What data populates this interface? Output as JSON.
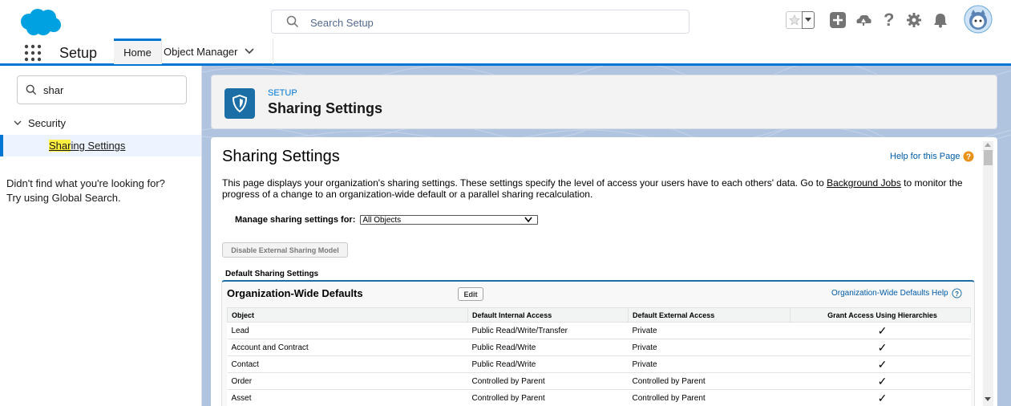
{
  "global_header": {
    "search_placeholder": "Search Setup"
  },
  "context_bar": {
    "app_name": "Setup",
    "tabs": [
      {
        "label": "Home"
      },
      {
        "label": "Object Manager"
      }
    ]
  },
  "sidebar": {
    "quickfind_value": "shar",
    "tree": {
      "section": "Security",
      "item_match": "Shar",
      "item_rest": "ing Settings"
    },
    "not_found_line1": "Didn't find what you're looking for?",
    "not_found_line2": "Try using Global Search."
  },
  "page_header": {
    "eyebrow": "SETUP",
    "title": "Sharing Settings"
  },
  "content": {
    "title": "Sharing Settings",
    "help_link": "Help for this Page",
    "intro_before": "This page displays your organization's sharing settings. These settings specify the level of access your users have to each others' data. Go to ",
    "intro_link": "Background Jobs",
    "intro_after": " to monitor the progress of a change to an organization-wide default or a parallel sharing recalculation.",
    "manage_label": "Manage sharing settings for:",
    "manage_value": "All Objects",
    "disable_button": "Disable External Sharing Model",
    "default_sharing_label": "Default Sharing Settings"
  },
  "owd": {
    "title": "Organization-Wide Defaults",
    "edit_label": "Edit",
    "help_link": "Organization-Wide Defaults Help",
    "columns": [
      "Object",
      "Default Internal Access",
      "Default External Access",
      "Grant Access Using Hierarchies"
    ],
    "rows": [
      {
        "object": "Lead",
        "internal": "Public Read/Write/Transfer",
        "external": "Private",
        "hier": "✓"
      },
      {
        "object": "Account and Contract",
        "internal": "Public Read/Write",
        "external": "Private",
        "hier": "✓"
      },
      {
        "object": "Contact",
        "internal": "Public Read/Write",
        "external": "Private",
        "hier": "✓"
      },
      {
        "object": "Order",
        "internal": "Controlled by Parent",
        "external": "Controlled by Parent",
        "hier": "✓"
      },
      {
        "object": "Asset",
        "internal": "Controlled by Parent",
        "external": "Controlled by Parent",
        "hier": "✓"
      }
    ]
  },
  "colors": {
    "brand_blue": "#0176d3",
    "cloud_blue": "#00a1e0",
    "header_badge": "#1b6ea6",
    "link": "#015ba7",
    "help_orange": "#e8921a"
  }
}
